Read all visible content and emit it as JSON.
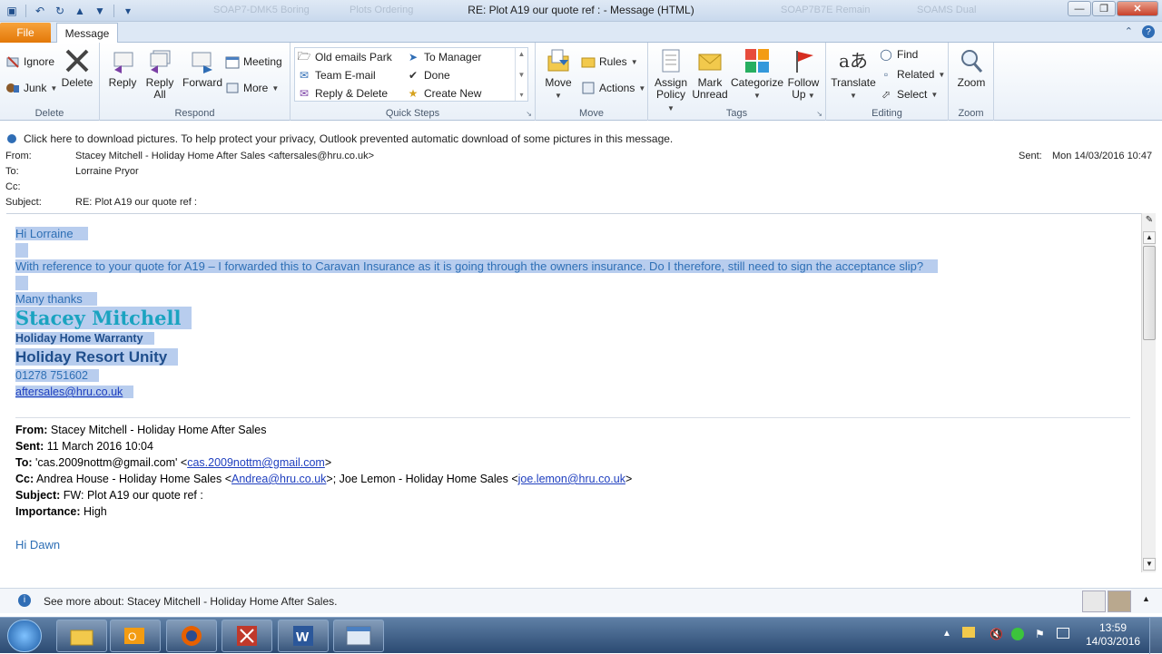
{
  "window": {
    "title": "RE: Plot A19  our quote ref :  - Message (HTML)",
    "bg_tabs_ghost": [
      "SOAP7-DMK5 Boring",
      "Plots Ordering",
      "SOAP7B7E Remain",
      "SOAMS Dual"
    ]
  },
  "tabs": {
    "file": "File",
    "message": "Message"
  },
  "ribbon": {
    "delete_group": {
      "label": "Delete",
      "ignore": "Ignore",
      "junk": "Junk",
      "delete": "Delete"
    },
    "respond_group": {
      "label": "Respond",
      "reply": "Reply",
      "reply_all_1": "Reply",
      "reply_all_2": "All",
      "forward": "Forward",
      "meeting": "Meeting",
      "more": "More"
    },
    "quick_steps": {
      "label": "Quick Steps",
      "items": [
        "Old emails Park",
        "To Manager",
        "Team E-mail",
        "Done",
        "Reply & Delete",
        "Create New"
      ]
    },
    "move_group": {
      "label": "Move",
      "move": "Move",
      "rules": "Rules",
      "actions": "Actions"
    },
    "tags_group": {
      "label": "Tags",
      "assign_1": "Assign",
      "assign_2": "Policy",
      "mark_1": "Mark",
      "mark_2": "Unread",
      "categorize": "Categorize",
      "follow_1": "Follow",
      "follow_2": "Up"
    },
    "editing_group": {
      "label": "Editing",
      "translate": "Translate",
      "find": "Find",
      "related": "Related",
      "select": "Select"
    },
    "zoom_group": {
      "label": "Zoom",
      "zoom": "Zoom"
    }
  },
  "infobar": "Click here to download pictures. To help protect your privacy, Outlook prevented automatic download of some pictures in this message.",
  "header": {
    "from_label": "From:",
    "from": "Stacey Mitchell - Holiday Home After Sales <aftersales@hru.co.uk>",
    "to_label": "To:",
    "to": "Lorraine Pryor",
    "cc_label": "Cc:",
    "subject_label": "Subject:",
    "subject": "RE: Plot A19  our quote ref :",
    "sent_label": "Sent:",
    "sent": "Mon 14/03/2016 10:47"
  },
  "body": {
    "greeting": "Hi Lorraine",
    "para": "With reference to your quote for A19 – I forwarded this to Caravan Insurance as it is going through the owners insurance. Do I therefore, still need to sign the acceptance slip?",
    "thanks": "Many thanks",
    "sig_name": "Stacey Mitchell",
    "sig_role": "Holiday Home Warranty",
    "sig_company": "Holiday Resort Unity",
    "sig_phone": "01278 751602",
    "sig_email": "aftersales@hru.co.uk"
  },
  "quoted": {
    "from_label": "From:",
    "from": "Stacey Mitchell - Holiday Home After Sales",
    "sent_label": "Sent:",
    "sent": "11 March 2016 10:04",
    "to_label": "To:",
    "to_pre": "'cas.2009nottm@gmail.com' <",
    "to_link": "cas.2009nottm@gmail.com",
    "to_post": ">",
    "cc_label": "Cc:",
    "cc_pre": "Andrea House - Holiday Home Sales <",
    "cc_link1": "Andrea@hru.co.uk",
    "cc_mid": ">; Joe Lemon - Holiday Home Sales <",
    "cc_link2": "joe.lemon@hru.co.uk",
    "cc_post": ">",
    "subject_label": "Subject:",
    "subject": "FW: Plot A19 our quote ref :",
    "importance_label": "Importance:",
    "importance": "High",
    "greeting": "Hi Dawn"
  },
  "people_bar": "See more about: Stacey Mitchell - Holiday Home After Sales.",
  "taskbar": {
    "time": "13:59",
    "date": "14/03/2016"
  }
}
